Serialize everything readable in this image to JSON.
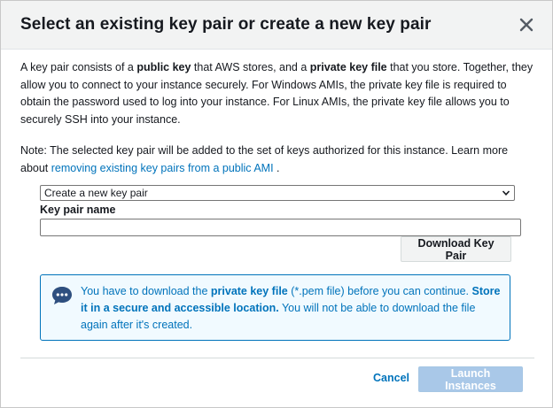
{
  "dialog": {
    "title": "Select an existing key pair or create a new key pair",
    "close_icon": "close-icon"
  },
  "description": {
    "t1": "A key pair consists of a ",
    "b1": "public key",
    "t2": " that AWS stores, and a ",
    "b2": "private key file",
    "t3": " that you store. Together, they allow you to connect to your instance securely. For Windows AMIs, the private key file is required to obtain the password used to log into your instance. For Linux AMIs, the private key file allows you to securely SSH into your instance."
  },
  "note": {
    "text": "Note: The selected key pair will be added to the set of keys authorized for this instance. Learn more about ",
    "link": "removing existing key pairs from a public AMI",
    "end": " ."
  },
  "form": {
    "select_value": "Create a new key pair",
    "key_pair_name_label": "Key pair name",
    "key_pair_name_value": "",
    "download_button": "Download Key Pair"
  },
  "info": {
    "icon": "chat-bubble-icon",
    "t1": "You have to download the ",
    "b1": "private key file",
    "t2": " (*.pem file) before you can continue. ",
    "b2": "Store it in a secure and accessible location.",
    "t3": " You will not be able to download the file again after it's created."
  },
  "footer": {
    "cancel": "Cancel",
    "launch": "Launch Instances"
  },
  "colors": {
    "link": "#0073bb",
    "header_bg": "#f2f3f3",
    "info_bg": "#f1faff",
    "launch_disabled": "#a9c8e8"
  }
}
